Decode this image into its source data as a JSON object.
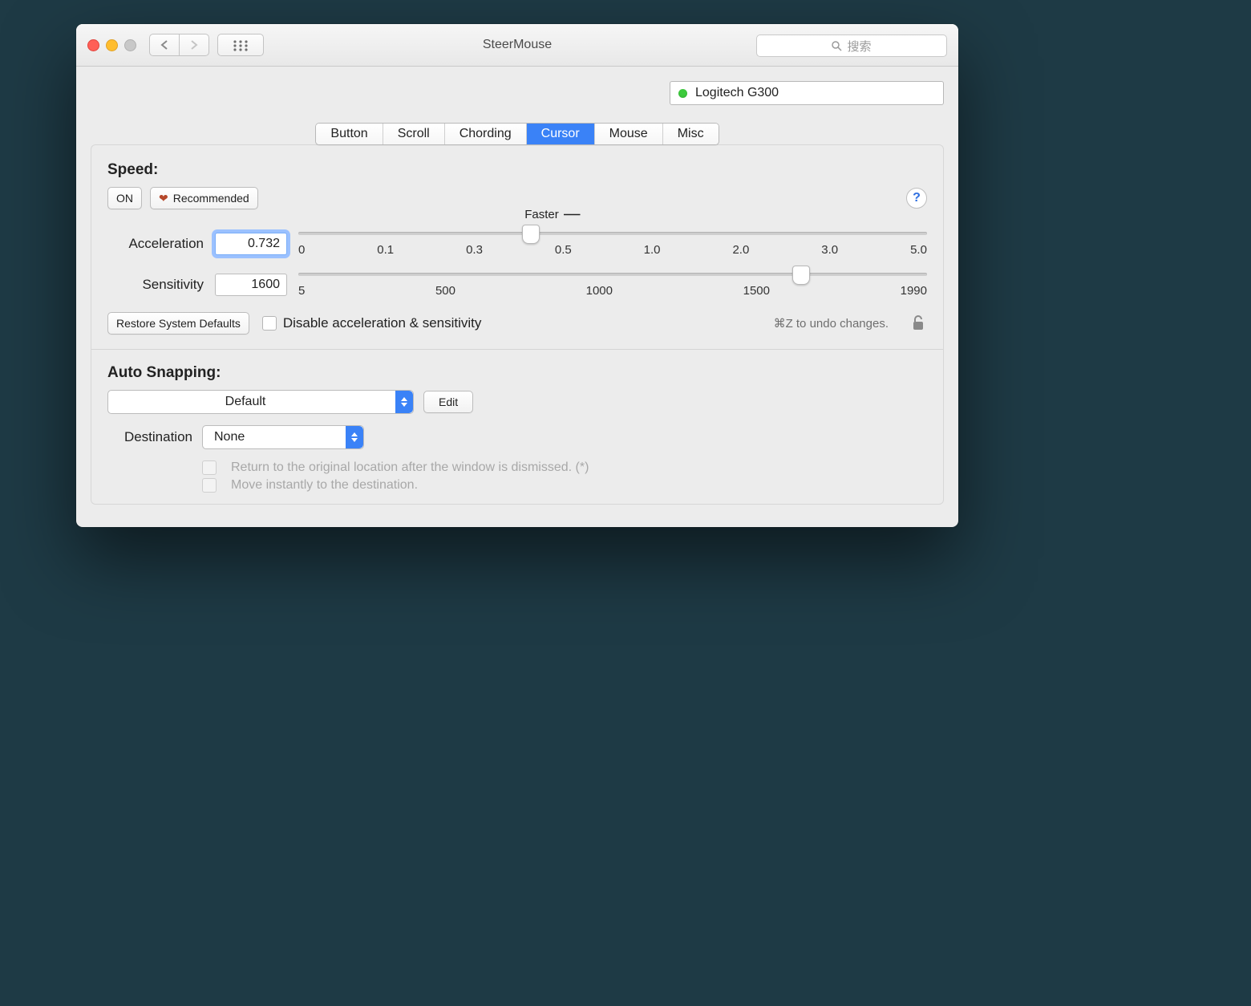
{
  "window": {
    "title": "SteerMouse"
  },
  "search": {
    "placeholder": "搜索"
  },
  "device": {
    "name": "Logitech G300",
    "status_color": "#3dcb3d"
  },
  "tabs": [
    "Button",
    "Scroll",
    "Chording",
    "Cursor",
    "Mouse",
    "Misc"
  ],
  "active_tab": "Cursor",
  "speed": {
    "title": "Speed:",
    "on_label": "ON",
    "recommended_label": "Recommended",
    "faster_label": "Faster",
    "accel": {
      "label": "Acceleration",
      "value": "0.732",
      "ticks": [
        "0",
        "0.1",
        "0.3",
        "0.5",
        "1.0",
        "2.0",
        "3.0",
        "5.0"
      ],
      "knob_pct": 37
    },
    "sens": {
      "label": "Sensitivity",
      "value": "1600",
      "ticks": [
        "5",
        "500",
        "1000",
        "1500",
        "1990"
      ],
      "knob_pct": 80
    },
    "restore_label": "Restore System Defaults",
    "disable_label": "Disable acceleration & sensitivity",
    "undo_hint": "⌘Z to undo changes."
  },
  "autosnap": {
    "title": "Auto Snapping:",
    "profile": "Default",
    "edit_label": "Edit",
    "dest_label": "Destination",
    "dest_value": "None",
    "opt_return": "Return to the original location after the window is dismissed. (*)",
    "opt_instant": "Move instantly to the destination."
  }
}
